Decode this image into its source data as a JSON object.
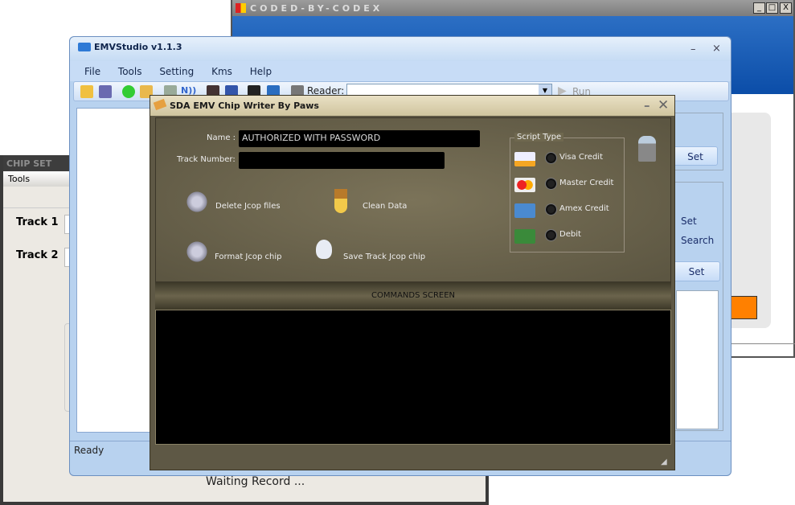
{
  "codex_window": {
    "title": "CODED-BY-CODEX",
    "controls": [
      "_",
      "□",
      "X"
    ],
    "accent": "#ff8000"
  },
  "chip_window": {
    "title": "CHIP SET",
    "menu": [
      "Tools"
    ],
    "track1_label": "Track 1",
    "track2_label": "Track 2",
    "status": "Waiting Record ..."
  },
  "emv_window": {
    "title": "EMVStudio v1.1.3",
    "menu": [
      "File",
      "Tools",
      "Setting",
      "Kms",
      "Help"
    ],
    "reader_label": "Reader:",
    "reader_value": "",
    "run_label": "Run",
    "status": "Ready",
    "set_button_1": "Set",
    "radio_set": "Set",
    "radio_search": "Search",
    "set_button_2": "Set"
  },
  "sda_window": {
    "title": "SDA EMV Chip Writer  By Paws",
    "name_label": "Name :",
    "name_value": "AUTHORIZED WITH PASSWORD",
    "track_label": "Track Number:",
    "track_value": "",
    "actions": [
      "Delete Jcop files",
      "Clean Data",
      "Format Jcop chip",
      "Save Track Jcop chip"
    ],
    "script_type_label": "Script Type",
    "script_types": [
      "Visa Credit",
      "Master Credit",
      "Amex Credit",
      "Debit"
    ],
    "commands_label": "COMMANDS SCREEN"
  }
}
